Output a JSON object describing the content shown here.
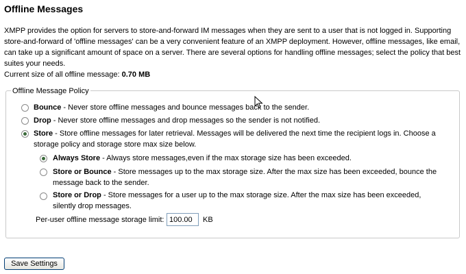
{
  "page": {
    "title": "Offline Messages",
    "intro": "XMPP provides the option for servers to store-and-forward IM messages when they are sent to a user that is not logged in. Supporting store-and-forward of 'offline messages' can be a very convenient feature of an XMPP deployment. However, offline messages, like email, can take up a significant amount of space on a server. There are several options for handling offline messages; select the policy that best suites your needs.",
    "current_size_label": "Current size of all offline message: ",
    "current_size_value": "0.70 MB"
  },
  "policy": {
    "legend": "Offline Message Policy",
    "options": [
      {
        "label": "Bounce",
        "desc": " - Never store offline messages and bounce messages back to the sender.",
        "selected": false
      },
      {
        "label": "Drop",
        "desc": " - Never store offline messages and drop messages so the sender is not notified.",
        "selected": false
      },
      {
        "label": "Store",
        "desc": " - Store offline messages for later retrieval. Messages will be delivered the next time the recipient logs in. Choose a storage policy and storage store max size below.",
        "selected": true
      }
    ],
    "store_options": [
      {
        "label": "Always Store",
        "desc": " - Always store messages,even if the max storage size has been exceeded.",
        "selected": true
      },
      {
        "label": "Store or Bounce",
        "desc": " - Store messages up to the max storage size. After the max size has been exceeded, bounce the message back to the sender.",
        "selected": false
      },
      {
        "label": "Store or Drop",
        "desc": " - Store messages for a user up to the max storage size. After the max size has been exceeded, silently drop messages.",
        "selected": false
      }
    ],
    "limit_label": "Per-user offline message storage limit:",
    "limit_value": "100.00",
    "limit_unit": "KB"
  },
  "actions": {
    "save_label": "Save Settings"
  }
}
